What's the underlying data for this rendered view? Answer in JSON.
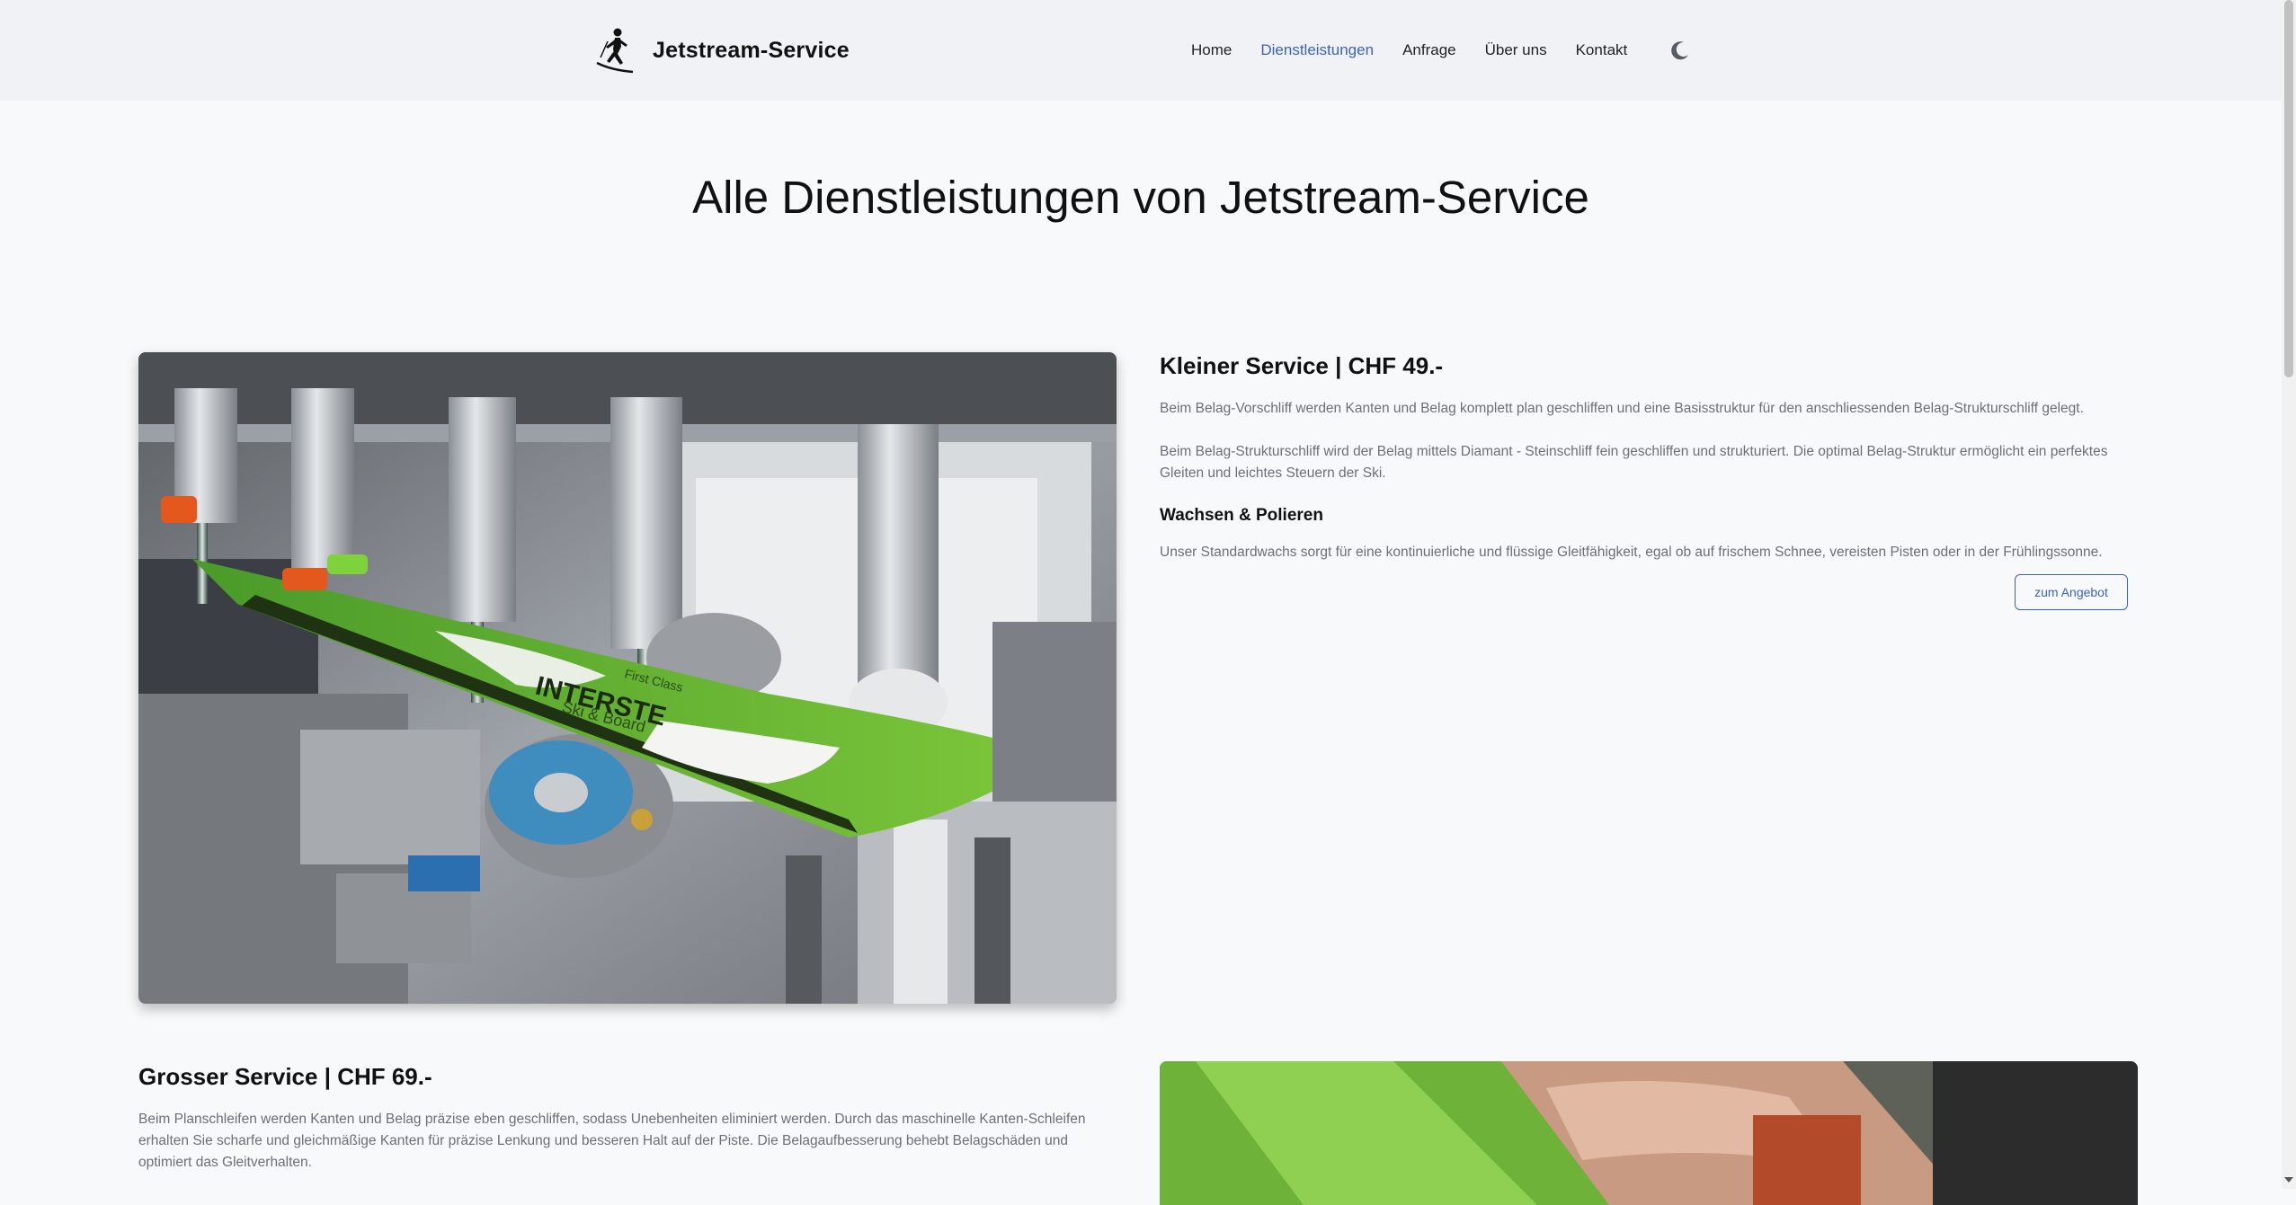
{
  "header": {
    "brand_name": "Jetstream-Service",
    "logo_icon": "skier-icon",
    "nav": [
      "Home",
      "Dienstleistungen",
      "Anfrage",
      "Über uns",
      "Kontakt"
    ],
    "active_nav": "Dienstleistungen",
    "theme_icon": "moon-icon"
  },
  "colors": {
    "accent": "#3a63c2",
    "background": "#f8f9fb",
    "header_bg": "#f0f2f5",
    "text_muted": "#6b6f76"
  },
  "page_title": "Alle Dienstleistungen von Jetstream-Service",
  "services": [
    {
      "title": "Kleiner Service | CHF 49.-",
      "paragraphs": [
        "Beim Belag-Vorschliff werden Kanten und Belag komplett plan geschliffen und eine Basisstruktur für den anschliessenden Belag-Strukturschliff gelegt.",
        "Beim Belag-Strukturschliff wird der Belag mittels Diamant - Steinschliff fein geschliffen und strukturiert. Die optimal Belag-Struktur ermöglicht ein perfektes Gleiten und leichtes Steuern der Ski."
      ],
      "subtitle": "Wachsen & Polieren",
      "sub_text": "Unser Standardwachs sorgt für eine kontinuierliche und flüssige Gleitfähigkeit, egal ob auf frischem Schnee, vereisten Pisten oder in der Frühlingssonne.",
      "button_label": "zum Angebot",
      "image_label": "INTERSTE",
      "image_label2": "Ski & Board",
      "image_label3": "First Class"
    },
    {
      "title": "Grosser Service | CHF 69.-",
      "paragraphs": [
        "Beim Planschleifen werden Kanten und Belag präzise eben geschliffen, sodass Unebenheiten eliminiert werden. Durch das maschinelle Kanten-Schleifen erhalten Sie scharfe und gleichmäßige Kanten für präzise Lenkung und besseren Halt auf der Piste. Die Belagaufbesserung behebt Belagschäden und optimiert das Gleitverhalten."
      ]
    }
  ]
}
